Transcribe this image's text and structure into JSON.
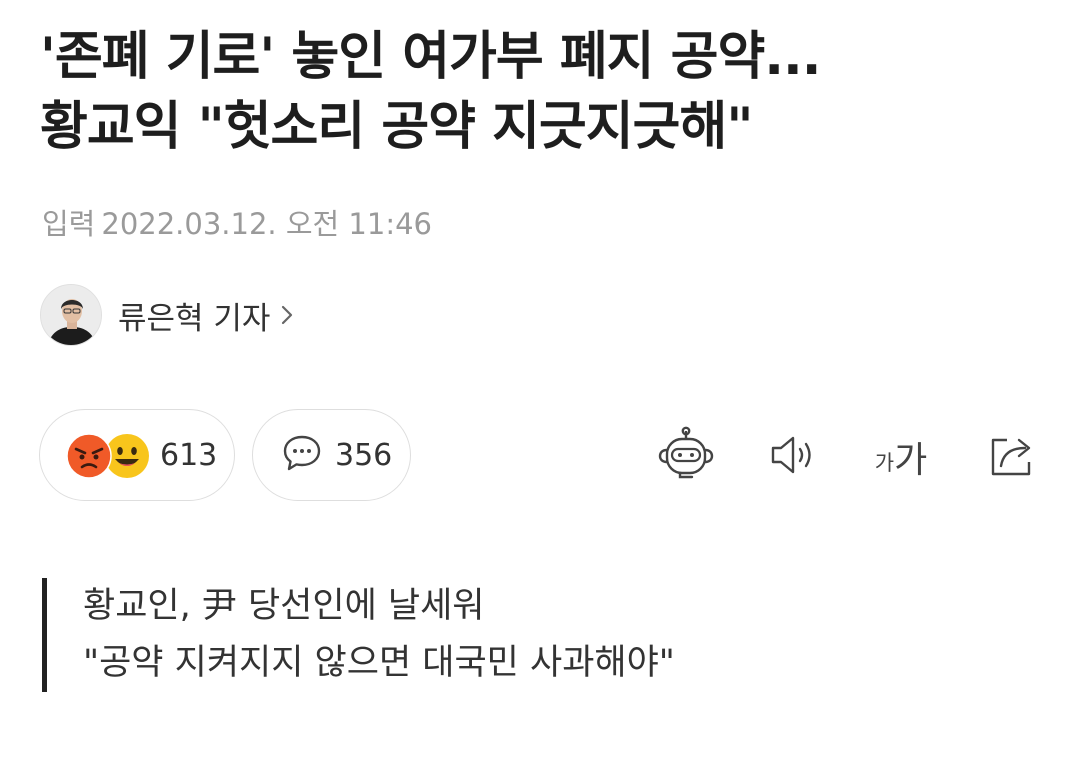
{
  "article": {
    "headline_line1": "'존폐 기로' 놓인 여가부 폐지 공약...",
    "headline_line2": "황교익 \"헛소리 공약 지긋지긋해\"",
    "published_label": "입력",
    "published_time": "2022.03.12. 오전 11:46",
    "reporter": "류은혁 기자",
    "subtitle_line1": "황교인, 尹 당선인에 날세워",
    "subtitle_line2": "\"공약 지켜지지 않으면 대국민 사과해야\""
  },
  "reactions": {
    "count": "613",
    "emojis": [
      "angry-face",
      "grinning-face"
    ]
  },
  "comments": {
    "count": "356",
    "icon": "speech-bubble-icon"
  },
  "toolbar": {
    "icons": [
      "robot-summary-icon",
      "speaker-icon",
      "font-size-icon",
      "share-icon"
    ],
    "font_small": "가",
    "font_large": "가"
  },
  "colors": {
    "headline": "#1e1e1e",
    "meta": "#9a9a9a",
    "angry": "#f05a28",
    "happy": "#f8c51c",
    "pill_border": "#dedede"
  }
}
